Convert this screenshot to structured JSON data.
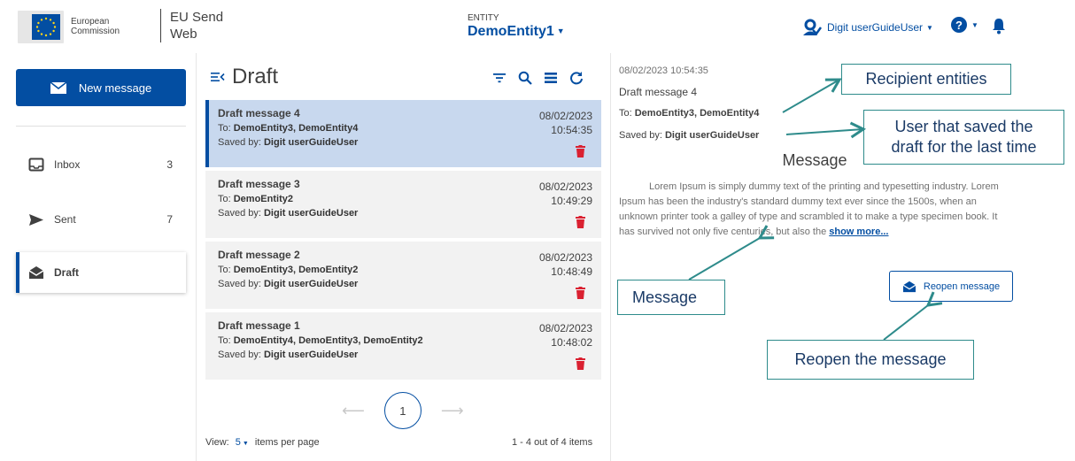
{
  "header": {
    "logo_line1": "European",
    "logo_line2": "Commission",
    "app_line1": "EU Send",
    "app_line2": "Web",
    "entity_label": "ENTITY",
    "entity_name": "DemoEntity1",
    "user_name": "Digit userGuideUser"
  },
  "sidebar": {
    "new_message": "New message",
    "items": [
      {
        "label": "Inbox",
        "count": "3",
        "icon": "inbox-icon"
      },
      {
        "label": "Sent",
        "count": "7",
        "icon": "sent-icon"
      },
      {
        "label": "Draft",
        "count": "",
        "icon": "draft-icon"
      }
    ]
  },
  "list": {
    "title": "Draft",
    "to_prefix": "To: ",
    "saved_prefix": "Saved by: ",
    "messages": [
      {
        "subject": "Draft message 4",
        "to": "DemoEntity3, DemoEntity4",
        "saved_by": "Digit userGuideUser",
        "date": "08/02/2023",
        "time": "10:54:35"
      },
      {
        "subject": "Draft message 3",
        "to": "DemoEntity2",
        "saved_by": "Digit userGuideUser",
        "date": "08/02/2023",
        "time": "10:49:29"
      },
      {
        "subject": "Draft message 2",
        "to": "DemoEntity3, DemoEntity2",
        "saved_by": "Digit userGuideUser",
        "date": "08/02/2023",
        "time": "10:48:49"
      },
      {
        "subject": "Draft message 1",
        "to": "DemoEntity4, DemoEntity3, DemoEntity2",
        "saved_by": "Digit userGuideUser",
        "date": "08/02/2023",
        "time": "10:48:02"
      }
    ],
    "page": "1",
    "view_label": "View:",
    "view_value": "5",
    "per_page_label": "items per page",
    "items_count": "1 - 4 out of 4 items"
  },
  "detail": {
    "datetime": "08/02/2023 10:54:35",
    "subject": "Draft message 4",
    "to_prefix": "To: ",
    "to": "DemoEntity3, DemoEntity4",
    "saved_prefix": "Saved by: ",
    "saved_by": "Digit userGuideUser",
    "body": "Lorem Ipsum is simply dummy text of the printing and typesetting industry. Lorem Ipsum has been the industry's standard dummy text ever since the 1500s, when an unknown printer took a galley of type and scrambled it to make a type specimen book. It has survived not only five centuries, but also the ",
    "show_more": "show more...",
    "reopen_label": "Reopen message"
  },
  "annotations": {
    "recipient_entities": "Recipient entities",
    "user_saved_line1": "User that saved the",
    "user_saved_line2": "draft for the last time",
    "message_heading": "Message",
    "message": "Message",
    "reopen": "Reopen the message"
  },
  "colors": {
    "primary": "#034ea2",
    "selected_bg": "#c8d8ee",
    "card_bg": "#f2f2f2",
    "trash": "#da2131",
    "annotation_line": "#2e8b8b"
  }
}
